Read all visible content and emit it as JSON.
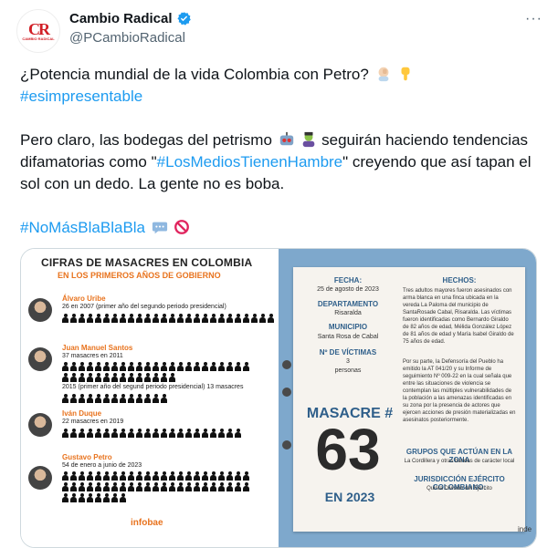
{
  "author": {
    "display_name": "Cambio Radical",
    "handle": "@PCambioRadical",
    "avatar_text": "CR",
    "avatar_subtext": "CAMBIO RADICAL"
  },
  "tweet": {
    "line1": "¿Potencia mundial de la vida Colombia con Petro?",
    "hashtag1": "#esimpresentable",
    "para2_a": "Pero claro, las bodegas del petrismo",
    "para2_b": "seguirán haciendo tendencias difamatorias como \"",
    "hashtag2": "#LosMediosTienenHambre",
    "para2_c": "\" creyendo que así tapan el sol con un dedo. La gente no es boba.",
    "hashtag3": "#NoMásBlaBlaBla"
  },
  "media": {
    "title": "CIFRAS DE MASACRES EN COLOMBIA",
    "subtitle": "EN LOS PRIMEROS AÑOS DE GOBIERNO",
    "people": [
      {
        "name": "Álvaro Uribe",
        "lines": [
          "26 en 2007 (primer año del segundo periodo presidencial)"
        ],
        "count": 26
      },
      {
        "name": "Juan Manuel Santos",
        "lines": [
          "37 masacres en 2011",
          "2015 (primer año del segund periodo presidencial) 13 masacres"
        ],
        "count": 37
      },
      {
        "name": "Iván Duque",
        "lines": [
          "22 masacres en 2019"
        ],
        "count": 22
      },
      {
        "name": "Gustavo Petro",
        "lines": [
          "54 de enero a junio de 2023"
        ],
        "count": 54
      }
    ],
    "source": "infobae",
    "card": {
      "fecha_label": "FECHA:",
      "fecha": "25 de agosto de 2023",
      "depto_label": "DEPARTAMENTO",
      "depto": "Risaralda",
      "mun_label": "MUNICIPIO",
      "mun": "Santa Rosa de Cabal",
      "victimas_label": "Nº DE VÍCTIMAS",
      "victimas": "3",
      "victimas_unit": "personas",
      "hechos_label": "HECHOS:",
      "hechos": "Tres adultos mayores fueron asesinados con arma blanca en una finca ubicada en la vereda La Paloma del municipio de SantaRosade Cabal, Risaralda. Las víctimas fueron identificadas como Bernardo Giraldo de 82 años de edad, Mélida González López de 81 años de edad y María Isabel Giraldo de 75 años de edad.",
      "hechos2": "Por su parte, la Defensoría del Pueblo ha emitido la AT 041/20 y su Informe de seguimiento Nº 009-22 en la cual señala que entre las situaciones de violencia se contemplan las múltiples vulnerabilidades de la población a las amenazas identificadas en su zona por la presencia de actores que ejercen acciones de presión materializadas en asesinatos posteriormente.",
      "masacre_label": "MASACRE #",
      "masacre_num": "63",
      "masacre_year": "EN 2023",
      "grupos_label": "GRUPOS QUE ACTÚAN EN LA ZONA",
      "grupos": "La Cordillera y otras bandas de carácter local",
      "jur_label": "JURISDICCIÓN EJÉRCITO COLOMBIANO:",
      "jur": "Quinta División del Ejército",
      "watermark": "inde"
    }
  },
  "colors": {
    "link": "#1d9bf0",
    "muted": "#536471",
    "orange": "#e8731e",
    "blue": "#2f5f8a"
  }
}
